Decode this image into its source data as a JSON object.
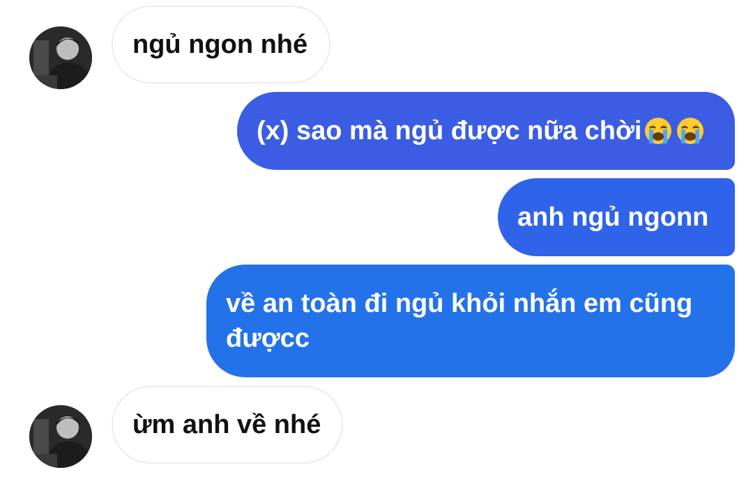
{
  "messages": [
    {
      "side": "incoming",
      "text": "ngủ ngon nhé"
    },
    {
      "side": "outgoing",
      "text": "(x) sao mà ngủ được nữa chời",
      "emojis": [
        "crying-face-emoji",
        "crying-face-emoji"
      ]
    },
    {
      "side": "outgoing",
      "text": "anh ngủ ngonn"
    },
    {
      "side": "outgoing",
      "text": "về an toàn đi ngủ khỏi nhắn em cũng đượcc"
    },
    {
      "side": "incoming",
      "text": "ừm anh về nhé"
    }
  ],
  "colors": {
    "outgoing_top": "#3a5de4",
    "outgoing_mid": "#2f63e9",
    "outgoing_bottom": "#2472ea",
    "incoming_bg": "#ffffff",
    "incoming_text": "#111111"
  }
}
